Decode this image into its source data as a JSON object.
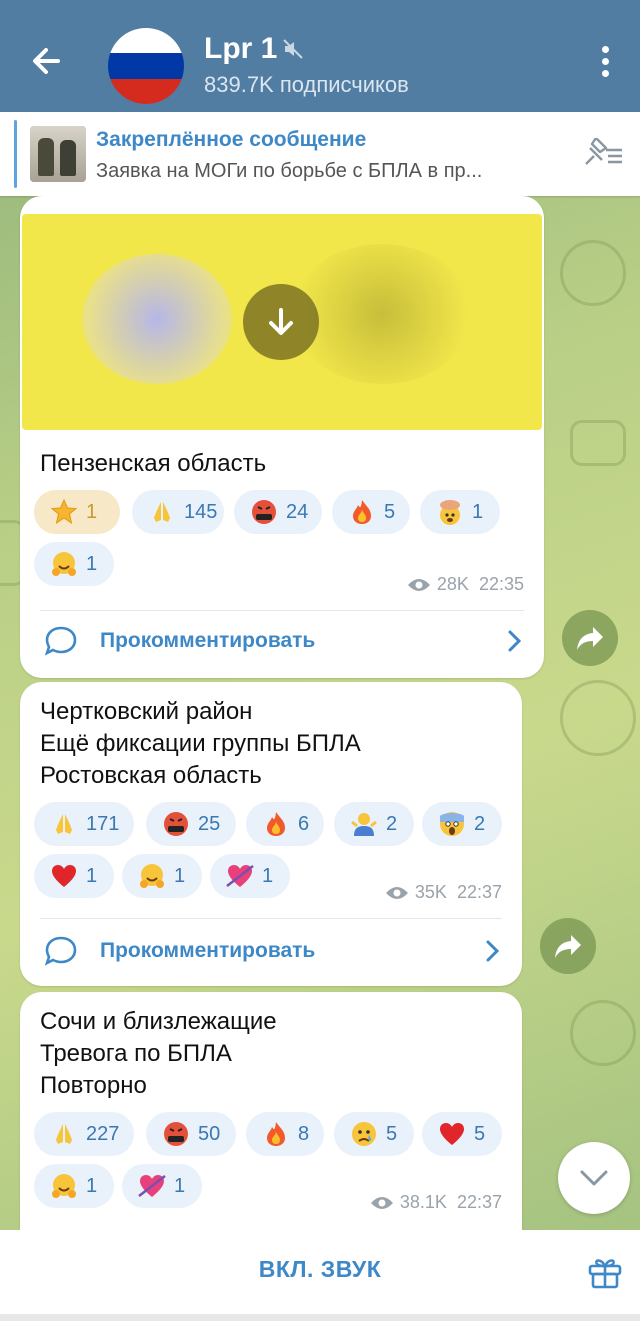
{
  "header": {
    "title": "Lpr 1",
    "subtitle": "839.7K подписчиков",
    "flag_colors": [
      "#ffffff",
      "#0039a6",
      "#d52b1e"
    ]
  },
  "pinned": {
    "title": "Закреплённое сообщение",
    "text": "Заявка на МОГи по борьбе с БПЛА в пр..."
  },
  "messages": [
    {
      "text_lines": [
        "Пензенская область"
      ],
      "reactions": [
        {
          "emoji": "star",
          "count": "1"
        },
        {
          "emoji": "folded-hands",
          "count": "145"
        },
        {
          "emoji": "cursing-face",
          "count": "24"
        },
        {
          "emoji": "fire",
          "count": "5"
        },
        {
          "emoji": "exploding-head",
          "count": "1"
        },
        {
          "emoji": "hugging-face",
          "count": "1"
        }
      ],
      "views": "28K",
      "time": "22:35",
      "comment_label": "Прокомментировать"
    },
    {
      "text_lines": [
        "Чертковский район",
        "Ещё фиксации группы БПЛА",
        "Ростовская область"
      ],
      "reactions": [
        {
          "emoji": "folded-hands",
          "count": "171"
        },
        {
          "emoji": "cursing-face",
          "count": "25"
        },
        {
          "emoji": "fire",
          "count": "6"
        },
        {
          "emoji": "shrugging-man",
          "count": "2"
        },
        {
          "emoji": "screaming-face",
          "count": "2"
        },
        {
          "emoji": "red-heart",
          "count": "1"
        },
        {
          "emoji": "hugging-face",
          "count": "1"
        },
        {
          "emoji": "heart-with-arrow",
          "count": "1"
        }
      ],
      "views": "35K",
      "time": "22:37",
      "comment_label": "Прокомментировать"
    },
    {
      "text_lines": [
        "Сочи и близлежащие",
        "Тревога по БПЛА",
        "Повторно"
      ],
      "reactions": [
        {
          "emoji": "folded-hands",
          "count": "227"
        },
        {
          "emoji": "cursing-face",
          "count": "50"
        },
        {
          "emoji": "fire",
          "count": "8"
        },
        {
          "emoji": "crying-face",
          "count": "5"
        },
        {
          "emoji": "red-heart",
          "count": "5"
        },
        {
          "emoji": "hugging-face",
          "count": "1"
        },
        {
          "emoji": "heart-with-arrow",
          "count": "1"
        }
      ],
      "views": "38.1K",
      "time": "22:37"
    }
  ],
  "bottom": {
    "unmute_label": "ВКЛ. ЗВУК"
  }
}
